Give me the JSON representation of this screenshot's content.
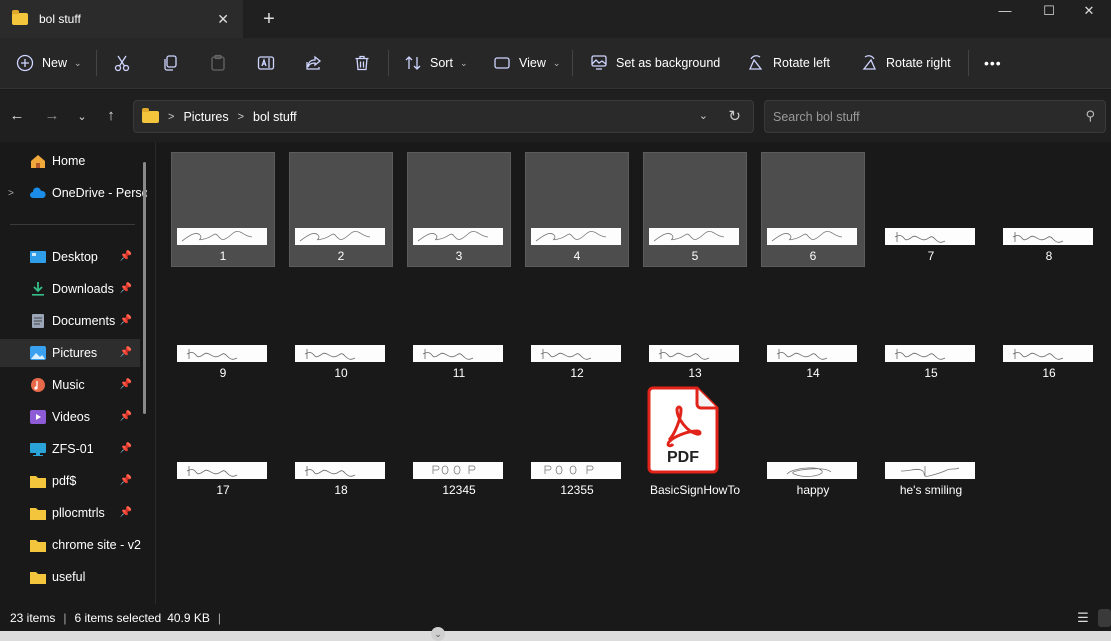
{
  "window": {
    "tab_title": "bol stuff",
    "close_tab": "✕",
    "new_tab": "+",
    "minimize": "—",
    "maximize": "☐",
    "close": "✕"
  },
  "toolbar": {
    "new_label": "New",
    "sort_label": "Sort",
    "view_label": "View",
    "set_background_label": "Set as background",
    "rotate_left_label": "Rotate left",
    "rotate_right_label": "Rotate right",
    "more_label": "•••"
  },
  "address": {
    "crumbs": [
      "Pictures",
      "bol stuff"
    ],
    "search_placeholder": "Search bol stuff"
  },
  "sidebar": {
    "items": [
      {
        "label": "Home",
        "icon": "home-icon",
        "pinned": false
      },
      {
        "label": "OneDrive - Perso",
        "icon": "onedrive-icon",
        "pinned": false
      },
      {
        "label": "Desktop",
        "icon": "desktop-icon",
        "pinned": true
      },
      {
        "label": "Downloads",
        "icon": "downloads-icon",
        "pinned": true
      },
      {
        "label": "Documents",
        "icon": "documents-icon",
        "pinned": true
      },
      {
        "label": "Pictures",
        "icon": "pictures-icon",
        "pinned": true,
        "selected": true
      },
      {
        "label": "Music",
        "icon": "music-icon",
        "pinned": true
      },
      {
        "label": "Videos",
        "icon": "videos-icon",
        "pinned": true
      },
      {
        "label": "ZFS-01",
        "icon": "drive-icon",
        "pinned": true
      },
      {
        "label": "pdf$",
        "icon": "folder-icon",
        "pinned": true
      },
      {
        "label": "pllocmtrls",
        "icon": "folder-icon",
        "pinned": true
      },
      {
        "label": "chrome site - v2",
        "icon": "folder-icon",
        "pinned": false
      },
      {
        "label": "useful",
        "icon": "folder-icon",
        "pinned": false
      }
    ]
  },
  "files": [
    {
      "name": "1",
      "selected": true,
      "sig": "a"
    },
    {
      "name": "2",
      "selected": true,
      "sig": "a"
    },
    {
      "name": "3",
      "selected": true,
      "sig": "a"
    },
    {
      "name": "4",
      "selected": true,
      "sig": "a"
    },
    {
      "name": "5",
      "selected": true,
      "sig": "a"
    },
    {
      "name": "6",
      "selected": true,
      "sig": "a"
    },
    {
      "name": "7",
      "selected": false,
      "sig": "b"
    },
    {
      "name": "8",
      "selected": false,
      "sig": "b"
    },
    {
      "name": "9",
      "selected": false,
      "sig": "b"
    },
    {
      "name": "10",
      "selected": false,
      "sig": "b"
    },
    {
      "name": "11",
      "selected": false,
      "sig": "b"
    },
    {
      "name": "12",
      "selected": false,
      "sig": "b"
    },
    {
      "name": "13",
      "selected": false,
      "sig": "b"
    },
    {
      "name": "14",
      "selected": false,
      "sig": "b"
    },
    {
      "name": "15",
      "selected": false,
      "sig": "b"
    },
    {
      "name": "16",
      "selected": false,
      "sig": "b"
    },
    {
      "name": "17",
      "selected": false,
      "sig": "b"
    },
    {
      "name": "18",
      "selected": false,
      "sig": "b"
    },
    {
      "name": "12345",
      "selected": false,
      "sig": "c"
    },
    {
      "name": "12355",
      "selected": false,
      "sig": "c"
    },
    {
      "name": "BasicSignHowTo",
      "selected": false,
      "sig": "pdf",
      "pdf_label": "PDF"
    },
    {
      "name": "happy",
      "selected": false,
      "sig": "d"
    },
    {
      "name": "he's smiling",
      "selected": false,
      "sig": "e"
    }
  ],
  "status": {
    "count": "23 items",
    "selected": "6 items selected",
    "size": "40.9 KB"
  },
  "colors": {
    "accent": "#4cc2ff",
    "pdf_red": "#e2231a",
    "folder": "#f2c53d"
  }
}
